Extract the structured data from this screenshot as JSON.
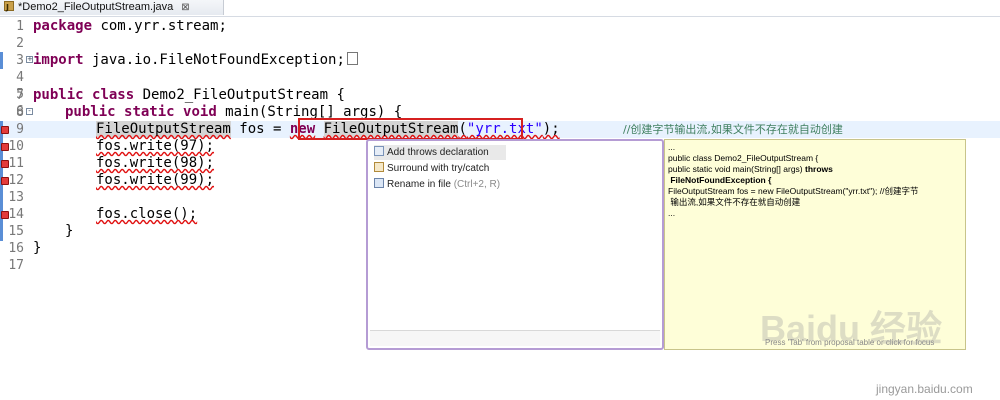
{
  "tab": {
    "title": "*Demo2_FileOutputStream.java",
    "close": "⊠",
    "icon": "J"
  },
  "lines": [
    {
      "n": "1"
    },
    {
      "n": "2"
    },
    {
      "n": "3"
    },
    {
      "n": "4"
    },
    {
      "n": "5"
    },
    {
      "n": "6"
    },
    {
      "n": "7"
    },
    {
      "n": "8"
    },
    {
      "n": "9"
    },
    {
      "n": "10"
    },
    {
      "n": "11"
    },
    {
      "n": "12"
    },
    {
      "n": "13"
    },
    {
      "n": "14"
    },
    {
      "n": "15"
    },
    {
      "n": "16"
    },
    {
      "n": "17"
    }
  ],
  "code": {
    "l1_kw": "package",
    "l1_rest": " com.yrr.stream;",
    "l3_kw": "import",
    "l3_rest": " java.io.FileNotFoundException;",
    "l7_kw1": "public",
    "l7_kw2": "class",
    "l7_rest": " Demo2_FileOutputStream {",
    "l8_kw1": "public",
    "l8_kw2": "static",
    "l8_kw3": "void",
    "l8_rest": " main(String[] args) {",
    "l9_type": "FileOutputStream",
    "l9_var": " fos = ",
    "l9_kw": "new",
    "l9_ctor": "FileOutputStream",
    "l9_open": "(",
    "l9_str": "\"yrr.txt\"",
    "l9_close": ");",
    "l9_comment": "//创建字节输出流,如果文件不存在就自动创建",
    "l10": "fos.write(97);",
    "l11": "fos.write(98);",
    "l12": "fos.write(99);",
    "l14": "fos.close();",
    "l15": "}",
    "l16": "}"
  },
  "quickfix": {
    "items": [
      {
        "label": "Add throws declaration",
        "icon": "throws-icon"
      },
      {
        "label": "Surround with try/catch",
        "icon": "surround-icon"
      },
      {
        "label": "Rename in file",
        "hint": "(Ctrl+2, R)",
        "icon": "rename-icon"
      }
    ]
  },
  "preview": {
    "lines": [
      "...",
      "public class Demo2_FileOutputStream {",
      "public static void main(String[] args) ",
      "throws",
      " FileNotFoundException {",
      "FileOutputStream fos = new FileOutputStream(\"yrr.txt\"); //创建字节",
      " 输出流,如果文件不存在就自动创建",
      "..."
    ],
    "footer": "Press 'Tab' from proposal table or click for focus"
  },
  "watermark": {
    "logo": "Baidu 经验",
    "site": "jingyan.baidu.com"
  }
}
